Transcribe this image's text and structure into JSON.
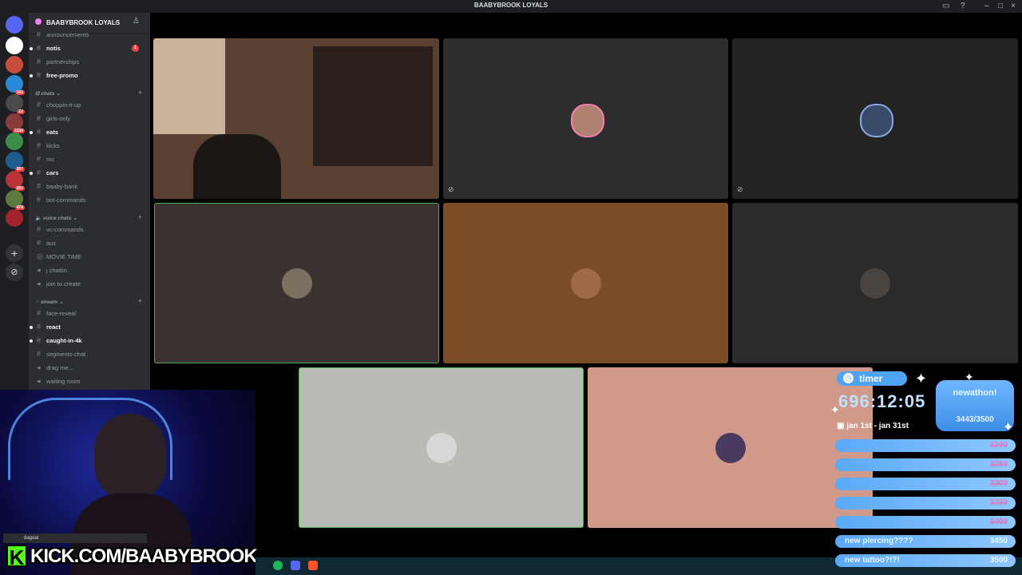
{
  "window": {
    "title": "BAABYBROOK LOYALS"
  },
  "server": {
    "name": "BAABYBROOK LOYALS"
  },
  "guild_badges": [
    "102",
    "22",
    "2330",
    "307",
    "262",
    "478"
  ],
  "channels": [
    {
      "name": "announcements",
      "bold": false
    },
    {
      "name": "notis",
      "bold": true,
      "badge": "1"
    },
    {
      "name": "partnerships",
      "bold": false
    },
    {
      "name": "free-promo",
      "bold": true
    }
  ],
  "cat_chats": "chats",
  "chats": [
    {
      "name": "choppin-it-up",
      "bold": false
    },
    {
      "name": "girls-only",
      "bold": false
    },
    {
      "name": "eats",
      "bold": true
    },
    {
      "name": "kicks",
      "bold": false
    },
    {
      "name": "mc",
      "bold": false
    },
    {
      "name": "cars",
      "bold": true
    },
    {
      "name": "baaby-bank",
      "bold": false
    },
    {
      "name": "bot-commands",
      "bold": false
    }
  ],
  "cat_voice": "voice chats",
  "voice": [
    {
      "name": "vc-commands",
      "bold": false
    },
    {
      "name": "aux",
      "bold": false
    },
    {
      "name": "MOVIE TIME",
      "bold": false
    },
    {
      "name": "j chattin",
      "bold": false
    },
    {
      "name": "join to create",
      "bold": false
    }
  ],
  "cat_stream": "stream",
  "stream": [
    {
      "name": "face-reveal",
      "bold": false
    },
    {
      "name": "react",
      "bold": true
    },
    {
      "name": "caught-in-4k",
      "bold": true
    },
    {
      "name": "segments-chat",
      "bold": false
    },
    {
      "name": "drag me...",
      "bold": false
    },
    {
      "name": "waiting room",
      "bold": false
    }
  ],
  "tile_colors": [
    "#3b3a3a",
    "#2d2d2d",
    "#232323",
    "#3a3130",
    "#7a4d26",
    "#2c2b2b",
    "#b9bbb6",
    "#d19989"
  ],
  "user_panel": {
    "name": "dagoat"
  },
  "overlay": {
    "kick_letter": "K",
    "kick_url": "KICK.COM/BAABYBROOK",
    "timer_label": "timer",
    "timer_value": "696:12:05",
    "newathon_title": "newathon!",
    "newathon_progress": "3443/3500",
    "date_range": "jan 1st - jan 31st",
    "goals": [
      {
        "label": "",
        "value": "3200",
        "done": true
      },
      {
        "label": "",
        "value": "3250",
        "done": true
      },
      {
        "label": "",
        "value": "3300",
        "done": true
      },
      {
        "label": "",
        "value": "3350",
        "done": true
      },
      {
        "label": "",
        "value": "3400",
        "done": true
      },
      {
        "label": "new piercing????",
        "value": "3450",
        "done": false
      },
      {
        "label": "new tattoo?!?!",
        "value": "3500",
        "done": false
      }
    ]
  }
}
